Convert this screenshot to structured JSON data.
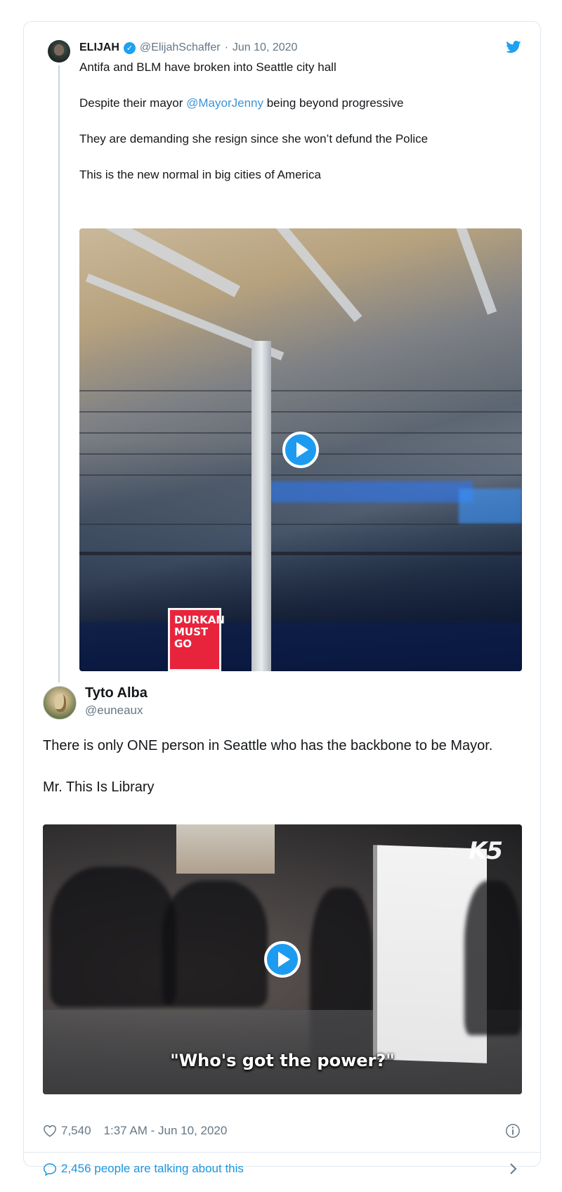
{
  "quoted_tweet": {
    "name": "ELIJAH",
    "handle": "@ElijahSchaffer",
    "separator": "·",
    "date": "Jun 10, 2020",
    "verified_icon": "verified-badge-icon",
    "line1": "Antifa and BLM have broken into Seattle city hall",
    "line2_before": "Despite their mayor ",
    "line2_mention": "@MayorJenny",
    "line2_after": " being beyond progressive",
    "line3": "They are demanding she resign since she won’t defund the Police",
    "line4": "This is the new normal in big cities of America",
    "video_sign_text": "DURKAN MUST GO"
  },
  "main_tweet": {
    "name": "Tyto Alba",
    "handle": "@euneaux",
    "text_p1": "There is only ONE person in Seattle who has the backbone to be Mayor.",
    "text_p2": "Mr. This Is Library",
    "video_logo": "K5",
    "video_caption": "\"Who's got the power?\""
  },
  "footer": {
    "likes": "7,540",
    "timestamp": "1:37 AM - Jun 10, 2020",
    "talking": "2,456 people are talking about this"
  },
  "colors": {
    "accent": "#1da1f2",
    "link": "#1b95e0",
    "secondary_text": "#657786",
    "border": "#e1e8ed"
  },
  "icons": [
    "twitter-bird-icon",
    "verified-badge-icon",
    "play-icon",
    "heart-icon",
    "info-icon",
    "speech-bubble-icon",
    "chevron-right-icon"
  ]
}
